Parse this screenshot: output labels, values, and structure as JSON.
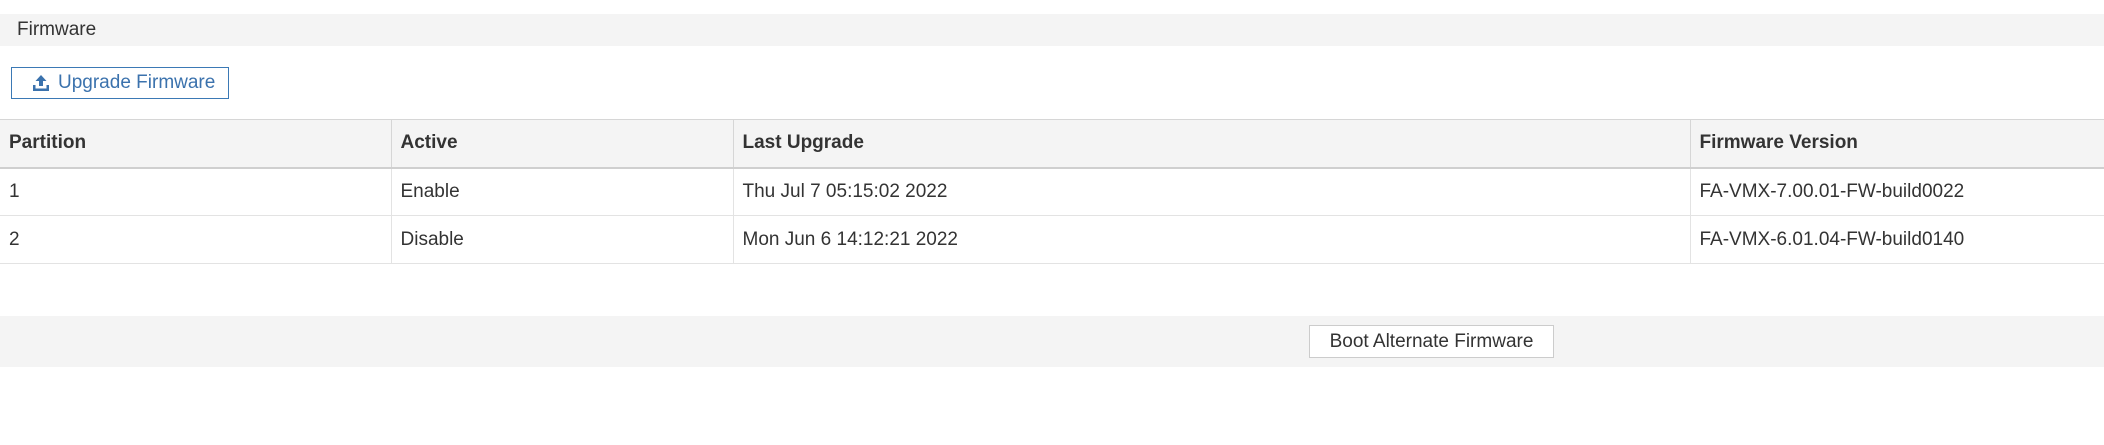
{
  "section": {
    "title": "Firmware"
  },
  "toolbar": {
    "upgrade_label": "Upgrade Firmware",
    "upgrade_icon": "upload-icon"
  },
  "table": {
    "columns": [
      "Partition",
      "Active",
      "Last Upgrade",
      "Firmware Version"
    ],
    "rows": [
      {
        "partition": "1",
        "active": "Enable",
        "last_upgrade": "Thu Jul 7 05:15:02 2022",
        "firmware_version": "FA-VMX-7.00.01-FW-build0022"
      },
      {
        "partition": "2",
        "active": "Disable",
        "last_upgrade": "Mon Jun 6 14:12:21 2022",
        "firmware_version": "FA-VMX-6.01.04-FW-build0140"
      }
    ]
  },
  "footer": {
    "boot_label": "Boot Alternate Firmware"
  },
  "colors": {
    "accent": "#3b72ad",
    "enable": "#6cae2b",
    "disable": "#e5332a",
    "header_bg": "#f4f4f4"
  }
}
